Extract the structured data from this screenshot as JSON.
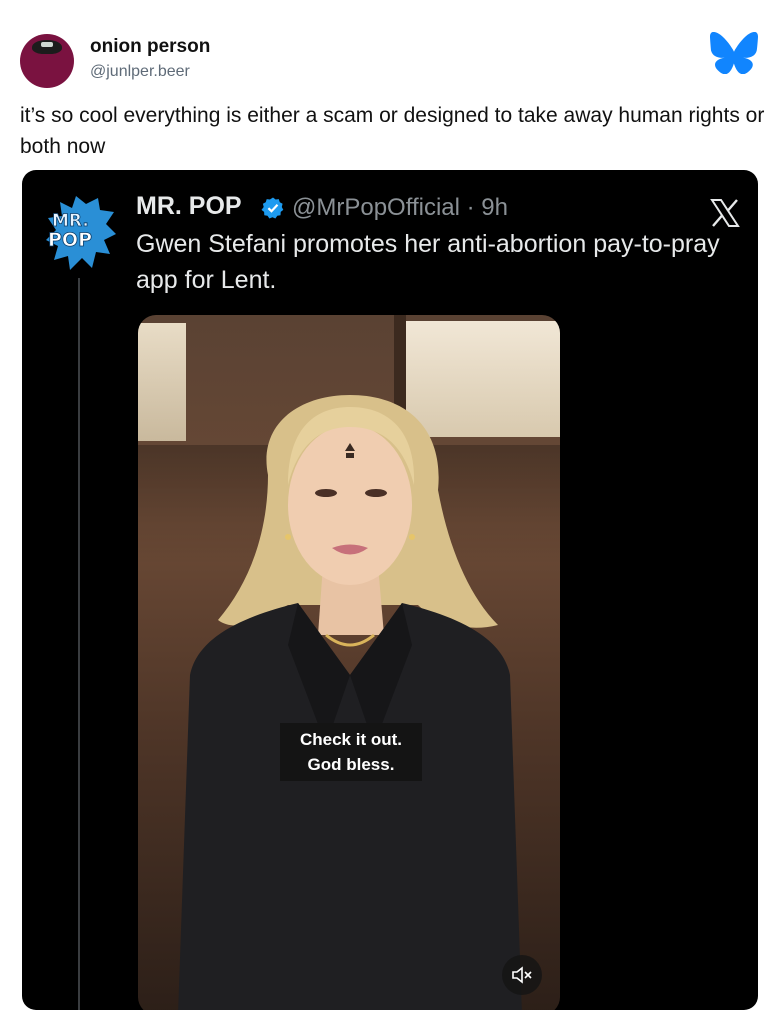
{
  "post": {
    "display_name": "onion person",
    "handle": "@junlper.beer",
    "text": "it’s so cool everything is either a scam or designed to take away human rights or both now",
    "platform_icon": "butterfly-icon",
    "brand_color": "#1185fe"
  },
  "embed": {
    "logo_text_top": "MR.",
    "logo_text_bottom": "POP",
    "display_name": "MR. POP",
    "handle_time": "@MrPopOfficial · 9h",
    "text": "Gwen Stefani promotes her anti-abortion pay-to-pray app for Lent.",
    "platform_icon": "x-logo-icon",
    "verified_color": "#1d9bf0",
    "video": {
      "caption_line1": "Check it out.",
      "caption_line2": "God bless.",
      "mute_icon": "speaker-muted-icon"
    }
  }
}
